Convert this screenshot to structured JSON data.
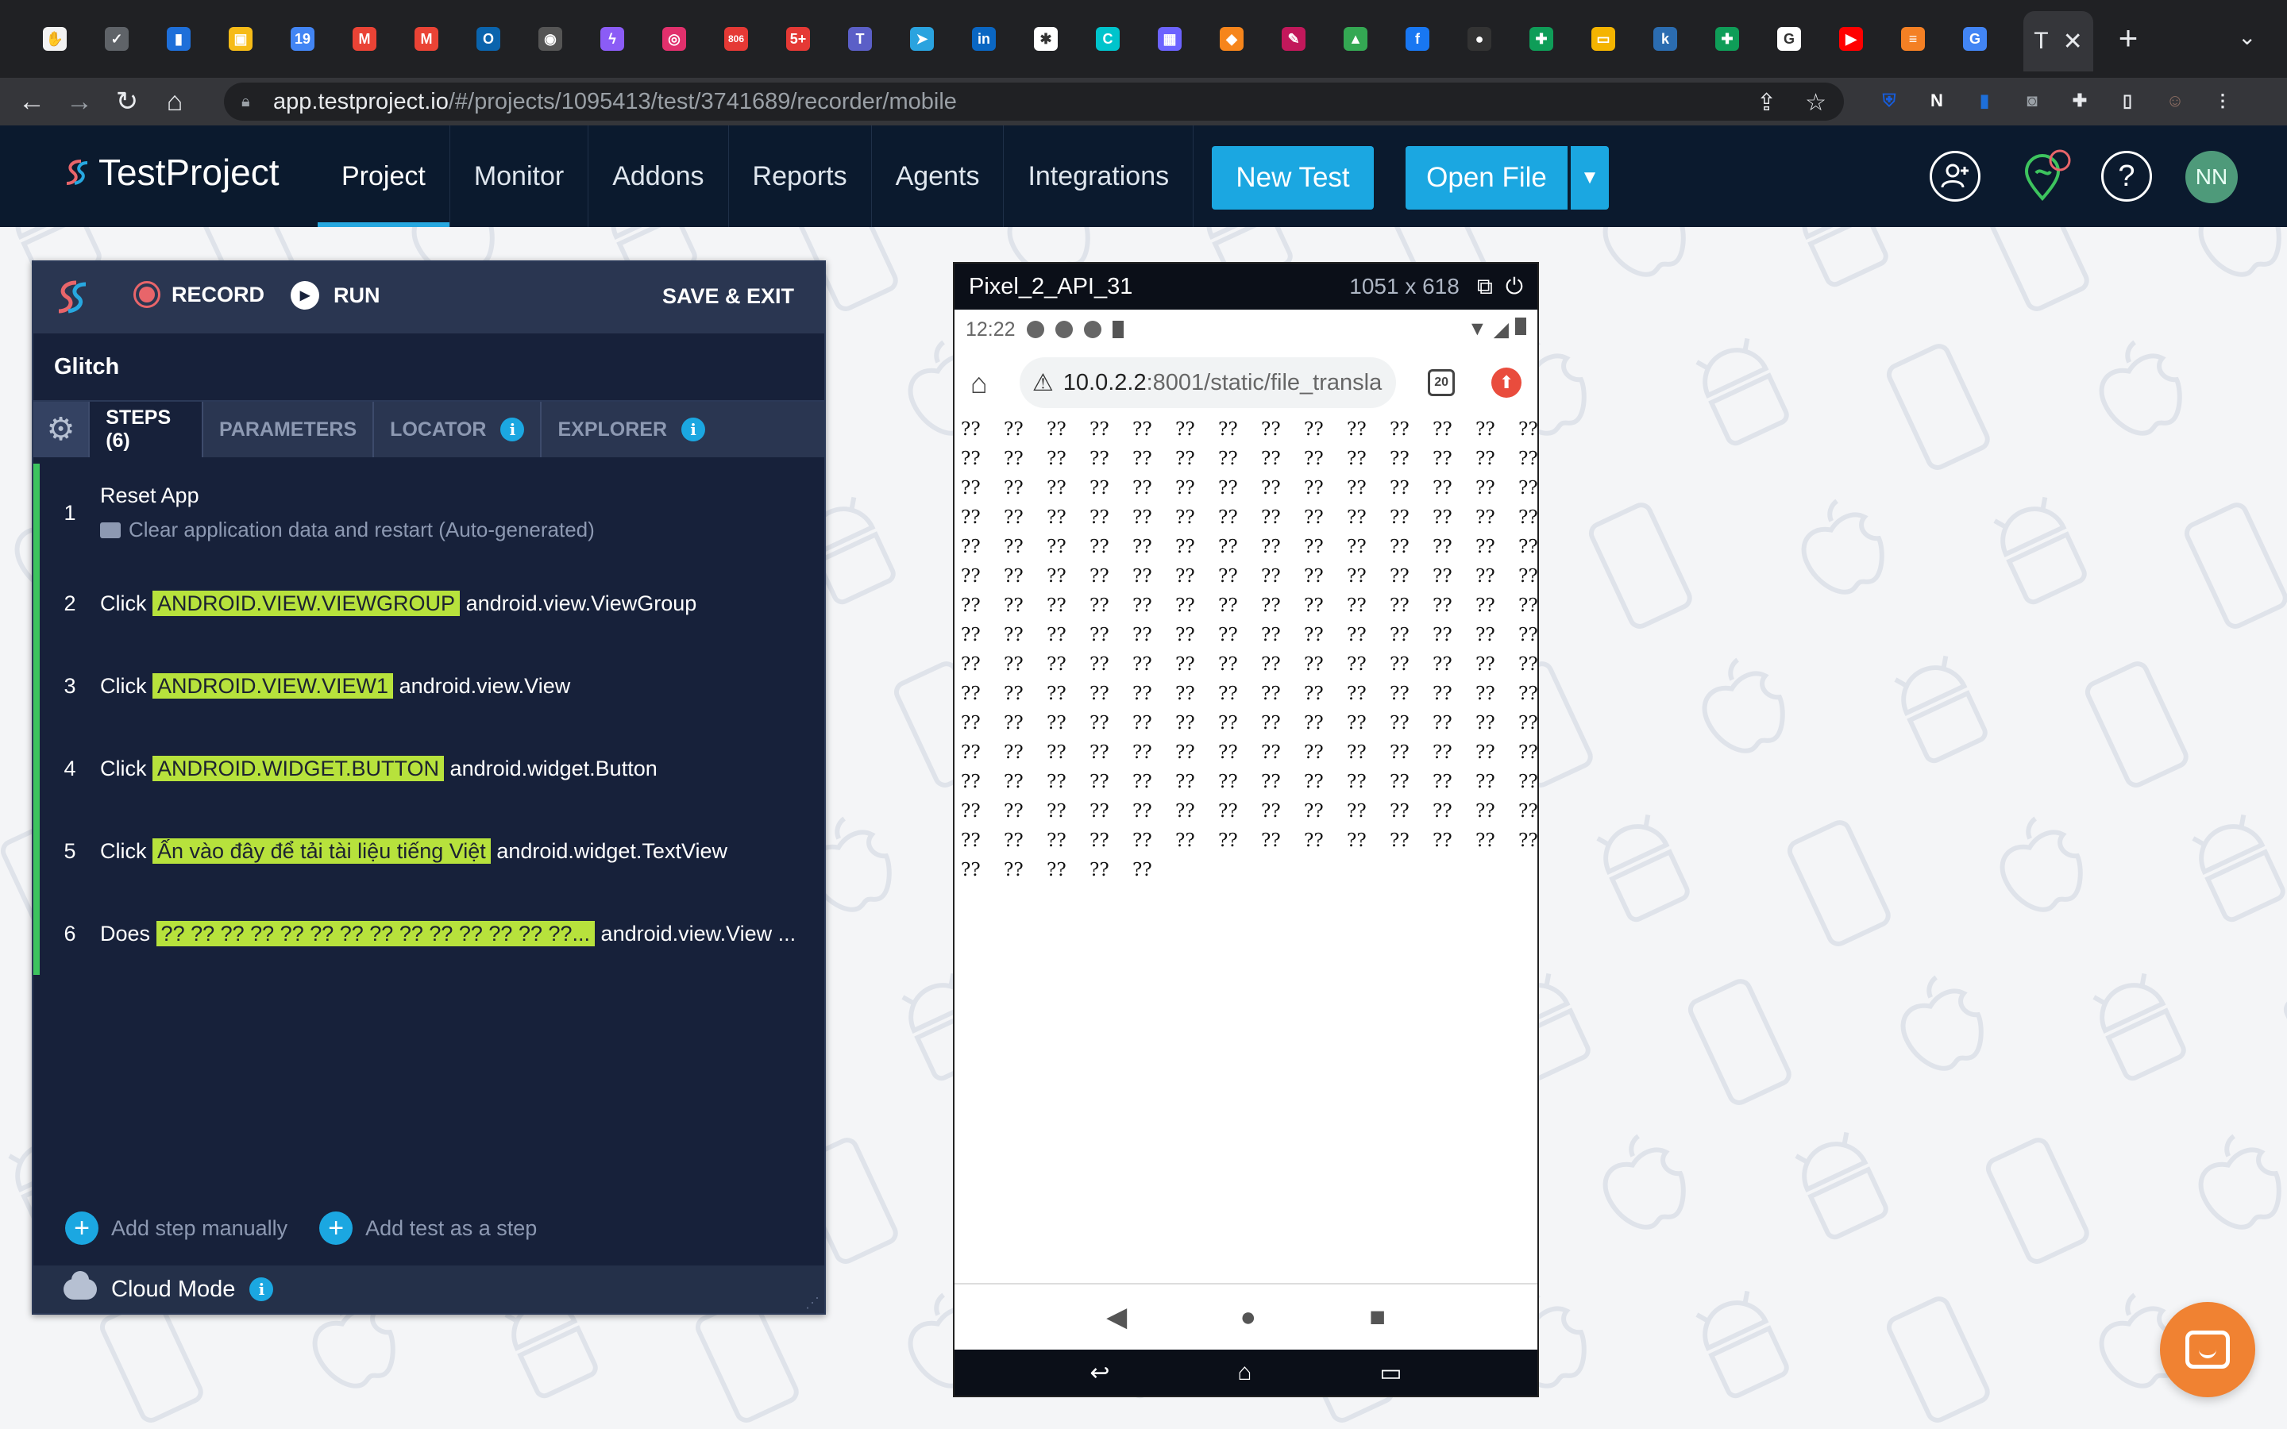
{
  "browser": {
    "url_host": "app.testproject.io",
    "url_path": "/#/projects/1095413/test/3741689/recorder/mobile",
    "active_tab_title": "T",
    "tab_favicons": [
      {
        "name": "hand-icon",
        "color": "#f2f2f2",
        "glyph": "✋"
      },
      {
        "name": "check-icon",
        "color": "#5f6368",
        "glyph": "✓"
      },
      {
        "name": "trello-icon",
        "color": "#1e6fd9",
        "glyph": "▮"
      },
      {
        "name": "keep-icon",
        "color": "#f6bb17",
        "glyph": "▣"
      },
      {
        "name": "calendar-icon",
        "color": "#4285f4",
        "glyph": "19"
      },
      {
        "name": "gmail-icon",
        "color": "#ea4335",
        "glyph": "M"
      },
      {
        "name": "gmail-icon-2",
        "color": "#ea4335",
        "glyph": "M"
      },
      {
        "name": "outlook-icon",
        "color": "#0a64ad",
        "glyph": "O"
      },
      {
        "name": "contact-icon",
        "color": "#555",
        "glyph": "◉"
      },
      {
        "name": "messenger-icon",
        "color": "#8b5cf6",
        "glyph": "ϟ"
      },
      {
        "name": "instagram-icon",
        "color": "#e1306c",
        "glyph": "◎"
      },
      {
        "name": "badge-806-icon",
        "color": "#e53935",
        "glyph": "806"
      },
      {
        "name": "badge-5-icon",
        "color": "#e53935",
        "glyph": "5+"
      },
      {
        "name": "teams-icon",
        "color": "#5b5fc7",
        "glyph": "T"
      },
      {
        "name": "telegram-icon",
        "color": "#2aa3df",
        "glyph": "➤"
      },
      {
        "name": "linkedin-icon",
        "color": "#0a66c2",
        "glyph": "in"
      },
      {
        "name": "pinwheel-icon",
        "color": "#ffffff",
        "glyph": "✱"
      },
      {
        "name": "canva-icon",
        "color": "#00c4cc",
        "glyph": "C"
      },
      {
        "name": "cube-icon",
        "color": "#6c63ff",
        "glyph": "▦"
      },
      {
        "name": "fox-icon",
        "color": "#f6851b",
        "glyph": "◆"
      },
      {
        "name": "quill-icon",
        "color": "#c2185b",
        "glyph": "✎"
      },
      {
        "name": "drive-icon",
        "color": "#34a853",
        "glyph": "▲"
      },
      {
        "name": "facebook-icon",
        "color": "#1877f2",
        "glyph": "f"
      },
      {
        "name": "github-icon",
        "color": "#333",
        "glyph": "●"
      },
      {
        "name": "sheets-icon",
        "color": "#0f9d58",
        "glyph": "✚"
      },
      {
        "name": "slides-icon",
        "color": "#f4b400",
        "glyph": "▭"
      },
      {
        "name": "k-icon",
        "color": "#2b6cb0",
        "glyph": "k"
      },
      {
        "name": "sheets-icon-2",
        "color": "#0f9d58",
        "glyph": "✚"
      },
      {
        "name": "google-icon",
        "color": "#ffffff",
        "glyph": "G"
      },
      {
        "name": "youtube-icon",
        "color": "#ff0000",
        "glyph": "▶"
      },
      {
        "name": "stackoverflow-icon",
        "color": "#f48024",
        "glyph": "≡"
      },
      {
        "name": "translate-icon",
        "color": "#4285f4",
        "glyph": "G"
      }
    ],
    "extensions": [
      {
        "name": "bitwarden-icon",
        "color": "#175ddc",
        "glyph": "⛨"
      },
      {
        "name": "notion-icon",
        "color": "#ffffff",
        "glyph": "N"
      },
      {
        "name": "trello-ext-icon",
        "color": "#1e6fd9",
        "glyph": "▮"
      },
      {
        "name": "chat-ext-icon",
        "color": "#9aa0a6",
        "glyph": "◙"
      },
      {
        "name": "puzzle-icon",
        "color": "#e8eaed",
        "glyph": "✚"
      },
      {
        "name": "sidepanel-icon",
        "color": "#e8eaed",
        "glyph": "▯"
      },
      {
        "name": "profile-icon",
        "color": "#8d6e63",
        "glyph": "☺"
      },
      {
        "name": "kebab-icon",
        "color": "#e8eaed",
        "glyph": "⋮"
      }
    ]
  },
  "app": {
    "logo_text": "TestProject",
    "nav": [
      "Project",
      "Monitor",
      "Addons",
      "Reports",
      "Agents",
      "Integrations"
    ],
    "active_nav": "Project",
    "new_test_label": "New Test",
    "open_file_label": "Open File",
    "avatar_initials": "NN",
    "accent": "#1ba7e1"
  },
  "recorder": {
    "record_label": "RECORD",
    "run_label": "RUN",
    "save_exit_label": "SAVE & EXIT",
    "test_name": "Glitch",
    "tabs": [
      "STEPS (6)",
      "PARAMETERS",
      "LOCATOR",
      "EXPLORER"
    ],
    "steps": [
      {
        "num": "1",
        "action": "Reset App",
        "target": "",
        "suffix": "",
        "comment": "Clear application data and restart (Auto-generated)"
      },
      {
        "num": "2",
        "action": "Click",
        "target": "ANDROID.VIEW.VIEWGROUP",
        "suffix": "android.view.ViewGroup",
        "comment": ""
      },
      {
        "num": "3",
        "action": "Click",
        "target": "ANDROID.VIEW.VIEW1",
        "suffix": "android.view.View",
        "comment": ""
      },
      {
        "num": "4",
        "action": "Click",
        "target": "ANDROID.WIDGET.BUTTON",
        "suffix": "android.widget.Button",
        "comment": ""
      },
      {
        "num": "5",
        "action": "Click",
        "target": "Ấn vào đây để tải tài liệu tiếng Việt",
        "suffix": "android.widget.TextView",
        "comment": ""
      },
      {
        "num": "6",
        "action": "Does",
        "target": "?? ?? ?? ?? ?? ?? ?? ?? ?? ?? ?? ?? ?? ??...",
        "suffix": "android.view.View ...",
        "comment": ""
      }
    ],
    "add_step_label": "Add step manually",
    "add_test_label": "Add test as a step",
    "cloud_mode_label": "Cloud Mode"
  },
  "device": {
    "name": "Pixel_2_API_31",
    "resolution": "1051 x 618",
    "clock": "12:22",
    "address_host": "10.0.2.2",
    "address_rest": ":8001/static/file_transla",
    "tab_count": "20",
    "page_token": "??",
    "page_token_count": 215
  }
}
